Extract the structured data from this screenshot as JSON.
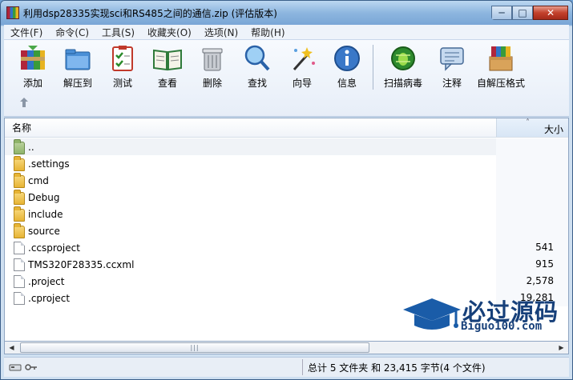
{
  "window": {
    "title": "利用dsp28335实现sci和RS485之间的通信.zip (评估版本)"
  },
  "window_buttons": {
    "minimize": "─",
    "maximize": "□",
    "close": "✕"
  },
  "menu": [
    "文件(F)",
    "命令(C)",
    "工具(S)",
    "收藏夹(O)",
    "选项(N)",
    "帮助(H)"
  ],
  "toolbar": {
    "add": "添加",
    "extract": "解压到",
    "test": "测试",
    "view": "查看",
    "delete": "删除",
    "find": "查找",
    "wizard": "向导",
    "info": "信息",
    "scan": "扫描病毒",
    "comment": "注释",
    "sfx": "自解压格式"
  },
  "columns": {
    "name": "名称",
    "size": "大小",
    "sort_glyph": "˄"
  },
  "files": [
    {
      "name": "..",
      "size": "",
      "kind": "parent"
    },
    {
      "name": ".settings",
      "size": "",
      "kind": "folder"
    },
    {
      "name": "cmd",
      "size": "",
      "kind": "folder"
    },
    {
      "name": "Debug",
      "size": "",
      "kind": "folder"
    },
    {
      "name": "include",
      "size": "",
      "kind": "folder"
    },
    {
      "name": "source",
      "size": "",
      "kind": "folder"
    },
    {
      "name": ".ccsproject",
      "size": "541",
      "kind": "file"
    },
    {
      "name": "TMS320F28335.ccxml",
      "size": "915",
      "kind": "file"
    },
    {
      "name": ".project",
      "size": "2,578",
      "kind": "file"
    },
    {
      "name": ".cproject",
      "size": "19,281",
      "kind": "file"
    }
  ],
  "hscroll": {
    "left": "◀",
    "right": "▶",
    "grip": "|||"
  },
  "status": {
    "text": "总计 5 文件夹 和 23,415 字节(4 个文件)"
  },
  "watermark": {
    "title": "必过源码",
    "url": "Biguo100.com"
  }
}
